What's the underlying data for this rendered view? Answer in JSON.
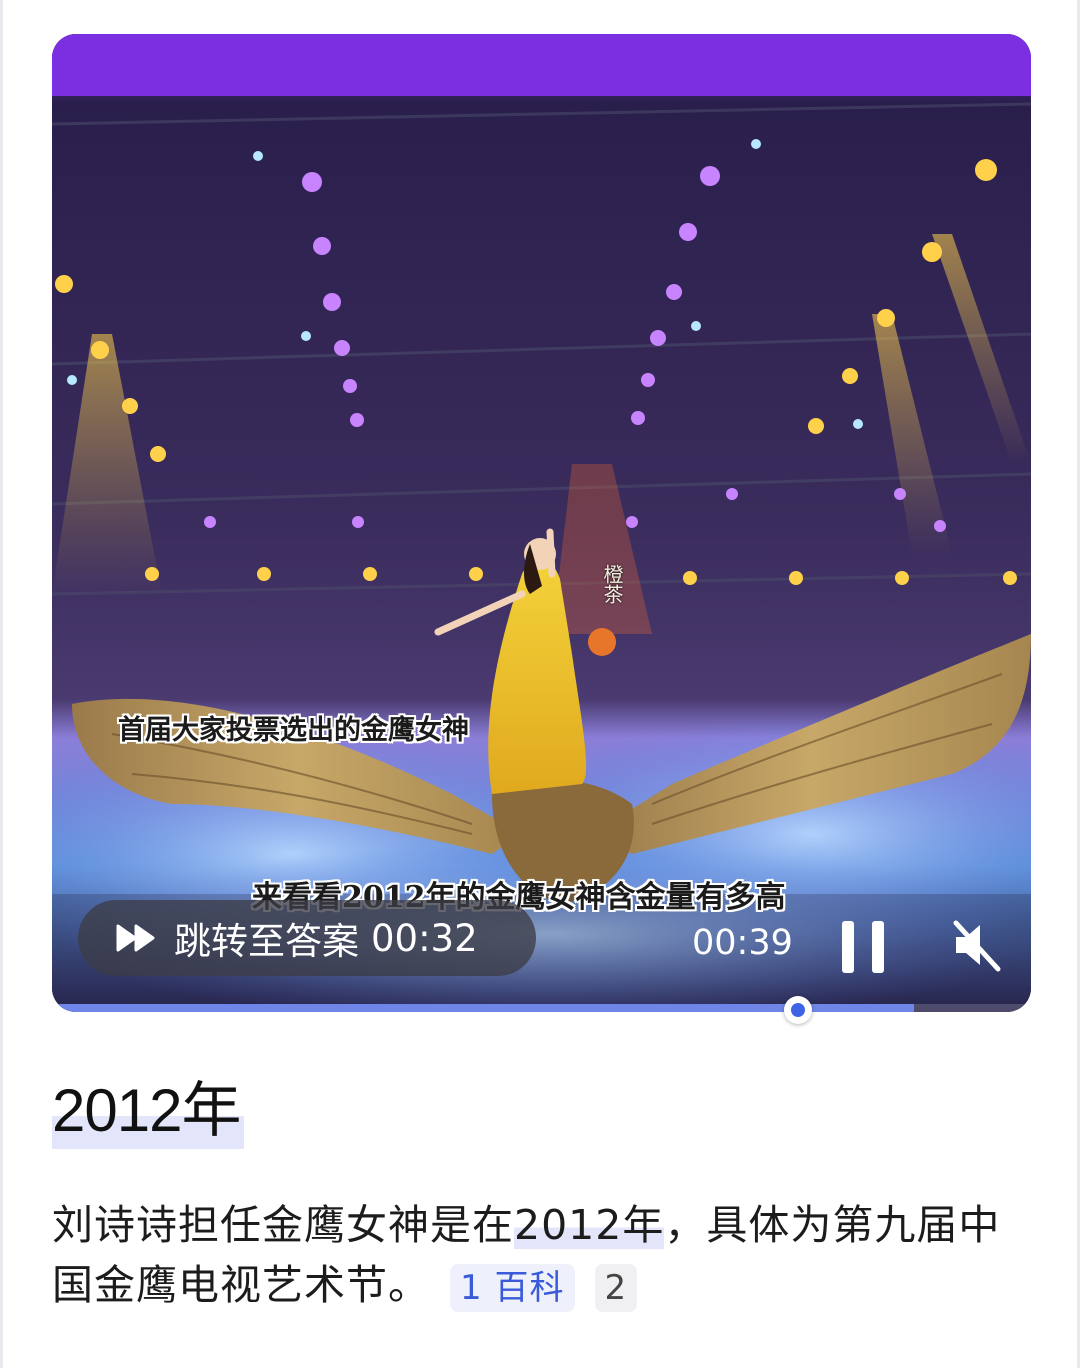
{
  "video": {
    "subtitle_top": "首届大家投票选出的金鹰女神",
    "subtitle_bottom": "来看看2012年的金鹰女神含金量有多高",
    "watermark": "橙茶",
    "skip_label": "跳转至答案",
    "skip_time": "00:32",
    "current_time": "00:39",
    "progress_fraction": 0.88,
    "buffered_fraction": 0.88
  },
  "answer": {
    "title": "2012年",
    "body_before": "刘诗诗担任金鹰女神是在",
    "body_highlight": "2012年",
    "body_after": "，具体为第九届中国金鹰电视艺术节。",
    "citations": [
      {
        "num": "1",
        "label": "百科"
      },
      {
        "num": "2",
        "label": ""
      }
    ]
  },
  "colors": {
    "accent": "#3e63e6",
    "highlight": "#e3e6fb",
    "progress": "#6f86e8"
  }
}
